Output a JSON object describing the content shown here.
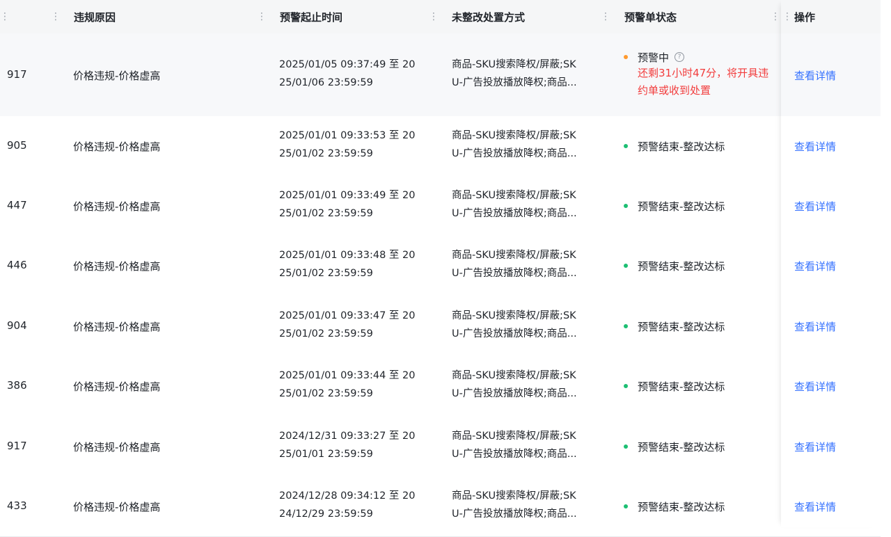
{
  "header": {
    "columns": [
      "违规原因",
      "预警起止时间",
      "未整改处置方式",
      "预警单状态",
      "操作"
    ]
  },
  "rows": [
    {
      "id": "917",
      "reason": "价格违规-价格虚高",
      "time1": "2025/01/05 09:37:49 至 20",
      "time2": "25/01/06 23:59:59",
      "method1": "商品-SKU搜索降权/屏蔽;SK",
      "method2": "U-广告投放播放降权;商品...",
      "status": "预警中",
      "status_color": "orange",
      "warning": "还剩31小时47分，将开具违约单或收到处置",
      "action": "查看详情"
    },
    {
      "id": "905",
      "reason": "价格违规-价格虚高",
      "time1": "2025/01/01 09:33:53 至 20",
      "time2": "25/01/02 23:59:59",
      "method1": "商品-SKU搜索降权/屏蔽;SK",
      "method2": "U-广告投放播放降权;商品...",
      "status": "预警结束-整改达标",
      "status_color": "green",
      "action": "查看详情"
    },
    {
      "id": "447",
      "reason": "价格违规-价格虚高",
      "time1": "2025/01/01 09:33:49 至 20",
      "time2": "25/01/02 23:59:59",
      "method1": "商品-SKU搜索降权/屏蔽;SK",
      "method2": "U-广告投放播放降权;商品...",
      "status": "预警结束-整改达标",
      "status_color": "green",
      "action": "查看详情"
    },
    {
      "id": "446",
      "reason": "价格违规-价格虚高",
      "time1": "2025/01/01 09:33:48 至 20",
      "time2": "25/01/02 23:59:59",
      "method1": "商品-SKU搜索降权/屏蔽;SK",
      "method2": "U-广告投放播放降权;商品...",
      "status": "预警结束-整改达标",
      "status_color": "green",
      "action": "查看详情"
    },
    {
      "id": "904",
      "reason": "价格违规-价格虚高",
      "time1": "2025/01/01 09:33:47 至 20",
      "time2": "25/01/02 23:59:59",
      "method1": "商品-SKU搜索降权/屏蔽;SK",
      "method2": "U-广告投放播放降权;商品...",
      "status": "预警结束-整改达标",
      "status_color": "green",
      "action": "查看详情"
    },
    {
      "id": "386",
      "reason": "价格违规-价格虚高",
      "time1": "2025/01/01 09:33:44 至 20",
      "time2": "25/01/02 23:59:59",
      "method1": "商品-SKU搜索降权/屏蔽;SK",
      "method2": "U-广告投放播放降权;商品...",
      "status": "预警结束-整改达标",
      "status_color": "green",
      "action": "查看详情"
    },
    {
      "id": "917",
      "reason": "价格违规-价格虚高",
      "time1": "2024/12/31 09:33:27 至 20",
      "time2": "25/01/01 23:59:59",
      "method1": "商品-SKU搜索降权/屏蔽;SK",
      "method2": "U-广告投放播放降权;商品...",
      "status": "预警结束-整改达标",
      "status_color": "green",
      "action": "查看详情"
    },
    {
      "id": "433",
      "reason": "价格违规-价格虚高",
      "time1": "2024/12/28 09:34:12 至 20",
      "time2": "24/12/29 23:59:59",
      "method1": "商品-SKU搜索降权/屏蔽;SK",
      "method2": "U-广告投放播放降权;商品...",
      "status": "预警结束-整改达标",
      "status_color": "green",
      "action": "查看详情"
    }
  ],
  "colors": {
    "link": "#3370ff",
    "warning_text": "#f23c3c",
    "status_green": "#1dbf73",
    "status_orange": "#ff9a2e"
  }
}
